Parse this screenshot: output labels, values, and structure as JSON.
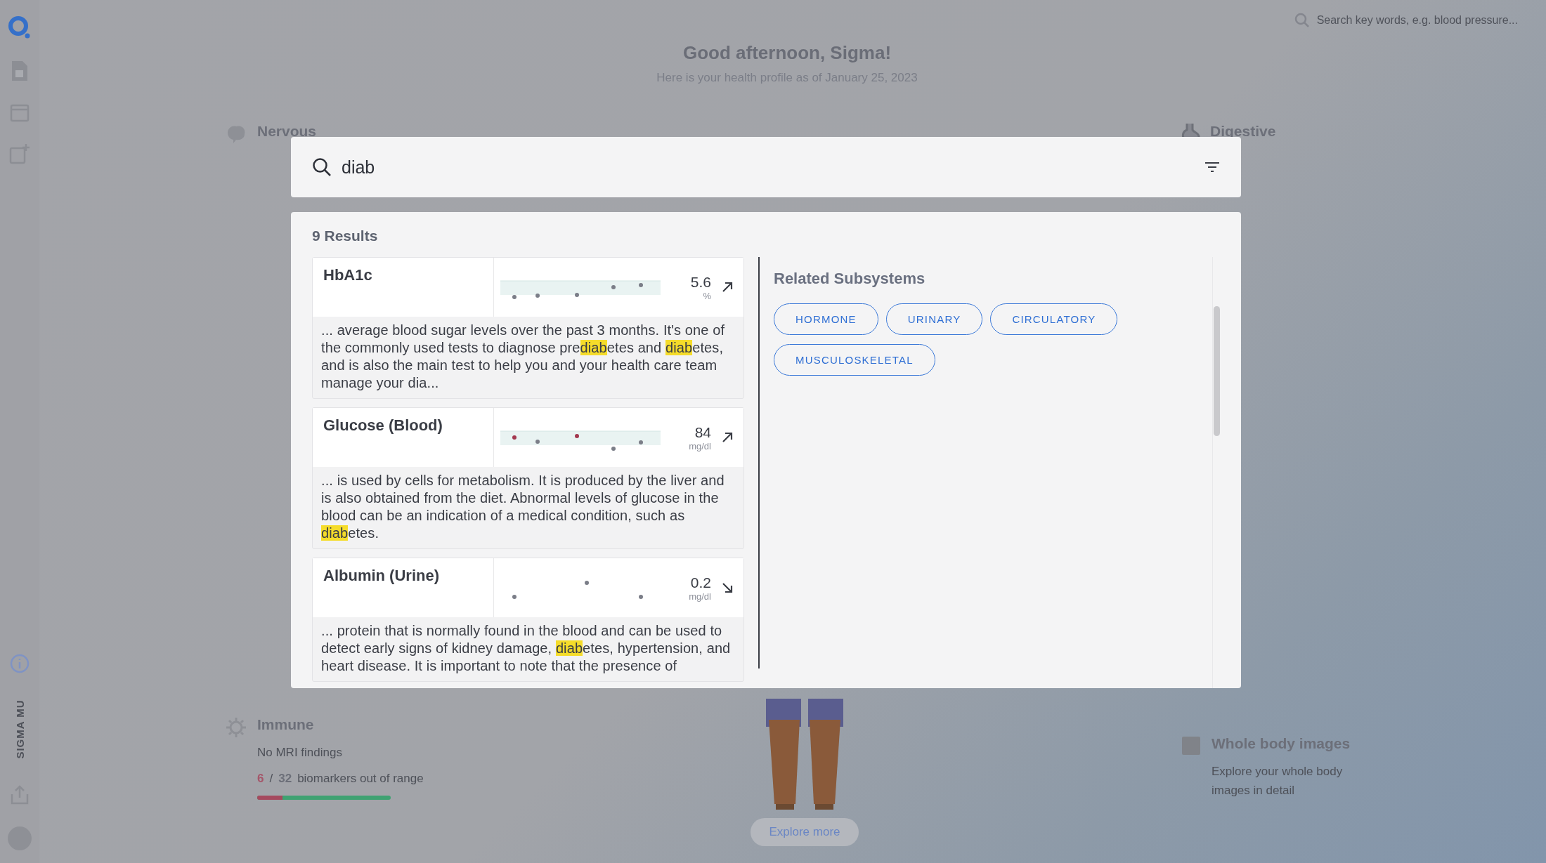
{
  "sidebar": {
    "vertical_label": "SIGMA MU"
  },
  "top_search": {
    "placeholder": "Search key words, e.g. blood pressure..."
  },
  "header": {
    "greeting": "Good afternoon, Sigma!",
    "subtitle": "Here is your health profile as of January 25, 2023"
  },
  "subsystems_left": [
    {
      "title": "Nervous"
    },
    {
      "title": "Immune",
      "finding": "No MRI findings",
      "out_of_range": "6",
      "separator": "/",
      "total": "32",
      "caption": "biomarkers out of range",
      "level": 0.19
    }
  ],
  "subsystems_right": [
    {
      "title": "Digestive"
    }
  ],
  "whole_body": {
    "title": "Whole body images",
    "text": "Explore your whole body images in detail"
  },
  "explore_button": "Explore more",
  "search": {
    "value": "diab"
  },
  "results": {
    "count_label": "9 Results",
    "items": [
      {
        "name": "HbA1c",
        "value": "5.6",
        "unit": "%",
        "rising": true,
        "snippet": "... average blood sugar levels over the past 3 months. It's one of the commonly used tests to diagnose pre**diab**etes and **diab**etes, and is also the main test to help you and your health care team manage your dia..."
      },
      {
        "name": "Glucose (Blood)",
        "value": "84",
        "unit": "mg/dl",
        "rising": true,
        "snippet": "... is used by cells for metabolism. It is produced by the liver and is also obtained from the diet. Abnormal levels of glucose in the blood can be an indication of a medical condition, such as **diab**etes."
      },
      {
        "name": "Albumin (Urine)",
        "value": "0.2",
        "unit": "mg/dl",
        "rising": false,
        "snippet": "... protein that is normally found in the blood and can be used to detect early signs of kidney damage, **diab**etes, hypertension, and heart disease. It is important to note that the presence of"
      }
    ]
  },
  "related": {
    "title": "Related Subsystems",
    "tags": [
      {
        "label": "HORMONE"
      },
      {
        "label": "URINARY"
      },
      {
        "label": "CIRCULATORY"
      },
      {
        "label": "MUSCULOSKELETAL"
      }
    ]
  }
}
